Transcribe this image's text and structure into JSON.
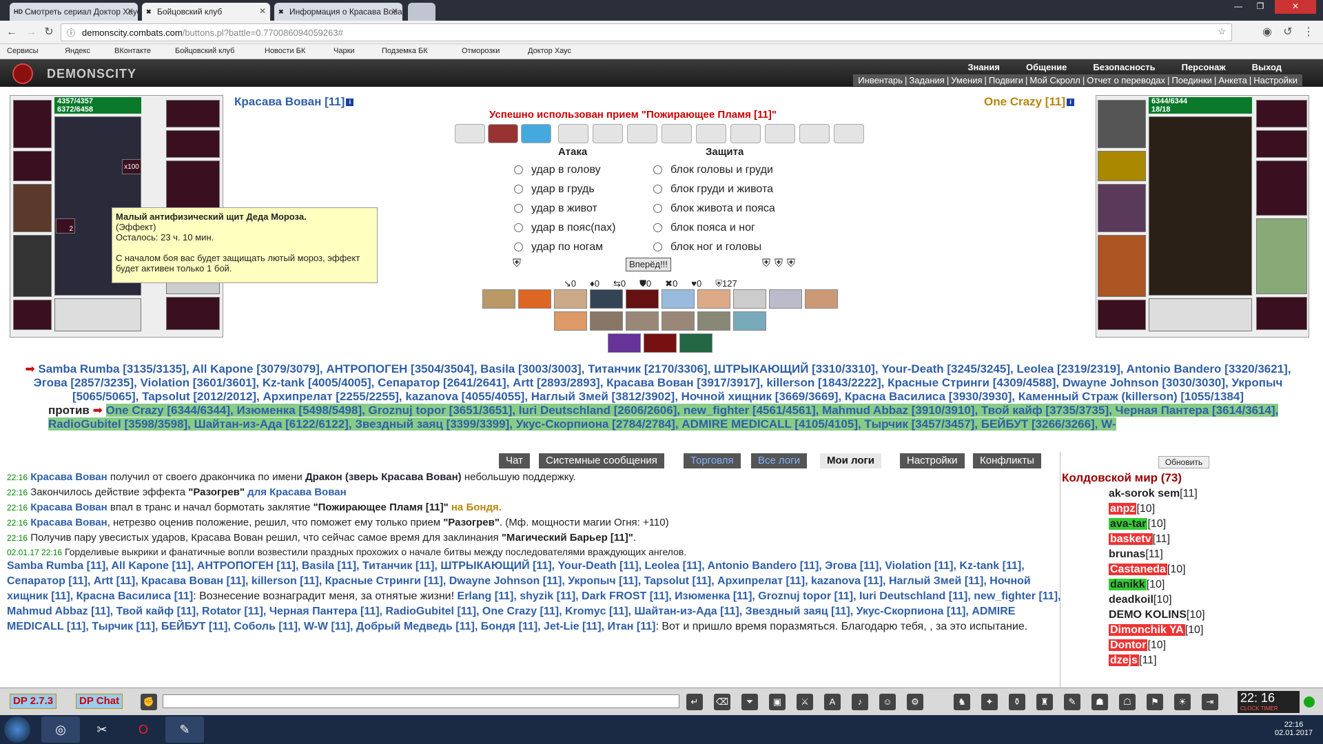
{
  "browser": {
    "tabs": [
      {
        "title": "Смотреть сериал Доктор Хаус",
        "fav": "HD"
      },
      {
        "title": "Бойцовский клуб",
        "fav": "✖"
      },
      {
        "title": "Информация о Красава Вован",
        "fav": "✖"
      }
    ],
    "url_host": "demonscity.combats.com",
    "url_path": "/buttons.pl?battle=0.770086094059263#",
    "bookmarks": [
      "Сервисы",
      "Яндекс",
      "ВКонтакте",
      "Бойцовский клуб",
      "Новости БК",
      "Чарки",
      "Подземка БК",
      "Отморозки",
      "Доктор Хаус"
    ]
  },
  "game": {
    "logo": "DEMONSCITY",
    "main_menu": [
      "Знания",
      "Общение",
      "Безопасность",
      "Персонаж",
      "Выход"
    ],
    "sub_menu": [
      "Инвентарь",
      "Задания",
      "Умения",
      "Подвиги",
      "Мой Скролл",
      "Отчет о переводах",
      "Поединки",
      "Анкета",
      "Настройки"
    ],
    "player": {
      "name": "Красава Вован [11]",
      "hp": "4357/4357",
      "mana": "6372/6458"
    },
    "opponent": {
      "name": "One Crazy [11]",
      "hp": "6344/6344",
      "mana": "18/18"
    },
    "tooltip": {
      "title": "Малый антифизический щит Деда Мороза.",
      "type": "(Эффект)",
      "remaining": "Осталось: 23 ч. 10 мин.",
      "desc": "С началом боя вас будет защищать лютый мороз, эффект будет активен только 1 бой."
    },
    "slot_badges": [
      "x100",
      "2"
    ],
    "success": "Успешно использован прием \"Пожирающее Пламя [11]\"",
    "attack_head": "Атака",
    "defense_head": "Защита",
    "attacks": [
      "удар в голову",
      "удар в грудь",
      "удар в живот",
      "удар в пояс(пах)",
      "удар по ногам"
    ],
    "defenses": [
      "блок головы и груди",
      "блок груди и живота",
      "блок живота и пояса",
      "блок пояса и ног",
      "блок ног и головы"
    ],
    "forward": "Вперёд!!!",
    "stats": [
      "0",
      "0",
      "0",
      "0",
      "0",
      "0",
      "127"
    ],
    "team_a_text": "Samba Rumba [3135/3135], All Kapone [3079/3079], АНТРОПОГЕН [3504/3504], Basila [3003/3003], Титанчик [2170/3306], ШТРЫКАЮЩИЙ [3310/3310], Your-Death [3245/3245], Leolea [2319/2319], Antonio Bandero [3320/3621], Эгова [2857/3235], Violation [3601/3601], Kz-tank [4005/4005], Сепаратор [2641/2641], Artt [2893/2893], Красава Вован [3917/3917], killerson [1843/2222], Красные Стринги [4309/4588], Dwayne Johnson [3030/3030], Укропыч [5065/5065], Tapsolut [2012/2012], Архипрелат [2255/2255], kazanova [4055/4055], Наглый Змей [3812/3902], Ночной хищник [3669/3669], Красна Василиса [3930/3930], Каменный Страж (killerson) [1055/1384]",
    "vs": "против",
    "team_b_text": "One Crazy [6344/6344], Изюменка [5498/5498], Groznuj topor [3651/3651], Iuri Deutschland [2606/2606], new_fighter [4561/4561], Mahmud Abbaz [3910/3910], Твой кайф [3735/3735], Черная Пантера [3614/3614], RadioGubitel [3598/3598], Шайтан-из-Ада [6122/6122], Звездный заяц [3399/3399], Укус-Скорпиона [2784/2784], ADMIRE MEDICALL [4105/4105], Тырчик [3457/3457], БЕЙБУТ [3266/3266], W-"
  },
  "chat": {
    "tabs": [
      "Чат",
      "Системные сообщения",
      "Торговля",
      "Все логи",
      "Мои логи",
      "Настройки",
      "Конфликты"
    ],
    "lines": [
      {
        "time": "22:16",
        "name": "Красава Вован",
        "text": " получил от своего дракончика по имени ",
        "bold": "Дракон (зверь Красава Вован)",
        "tail": " небольшую поддержку."
      },
      {
        "time": "22:16",
        "name": "",
        "text": "Закончилось действие эффекта ",
        "bold": "\"Разогрев\"",
        "tail": " для Красава Вован"
      },
      {
        "time": "22:16",
        "name": "Красава Вован",
        "text": " впал в транс и начал бормотать заклятие ",
        "bold": "\"Пожирающее Пламя [11]\"",
        "tail": " на Бондя."
      },
      {
        "time": "22:16",
        "name": "Красава Вован",
        "text": ", нетрезво оценив положение, решил, что поможет ему только прием ",
        "bold": "\"Разогрев\"",
        "tail": ". (Мф. мощности магии Огня: +110)"
      },
      {
        "time": "22:16",
        "name": "",
        "text": "Получив пару увесистых ударов, Красава Вован решил, что сейчас самое время для заклинания ",
        "bold": "\"Магический Барьер [11]\"",
        "tail": "."
      },
      {
        "time": "02.01.17 22:16",
        "name": "",
        "text": "Горделивые выкрики и фанатичные вопли возвестили праздных прохожих о начале битвы между последователями враждующих ангелов.",
        "bold": "",
        "tail": ""
      }
    ],
    "roster": "Samba Rumba [11], All Kapone [11], АНТРОПОГЕН [11], Basila [11], Титанчик [11], ШТРЫКАЮЩИЙ [11], Your-Death [11], Leolea [11], Antonio Bandero [11], Эгова [11], Violation [11], Kz-tank [11], Сепаратор [11], Artt [11], Красава Вован [11], killerson [11], Красные Стринги [11], Dwayne Johnson [11], Укропыч [11], Tapsolut [11], Архипрелат [11], kazanova [11], Наглый Змей [11], Ночной хищник [11], Красна Василиса [11]",
    "roster_quote1": ": Вознесение вознаградит меня, за отнятые жизни!",
    "roster2": "Erlang [11], shyzik [11], Dark FROST [11], Изюменка [11], Groznuj topor [11], Iuri Deutschland [11], new_fighter [11], Mahmud Abbaz [11], Твой кайф [11], Rotator [11], Черная Пантера [11], RadioGubitel [11], One Crazy [11], Kromyc [11], Шайтан-из-Ада [11], Звездный заяц [11], Укус-Скорпиона [11], ADMIRE MEDICALL [11], Тырчик [11], БЕЙБУТ [11], Соболь [11], W-W [11], Добрый Медведь [11], Бондя [11], Jet-Lie [11], Итан [11]",
    "roster_quote2": ": Вот и пришло время поразмяться. Благодарю тебя, , за это испытание."
  },
  "online": {
    "refresh": "Обновить",
    "title": "Колдовской мир (73)",
    "users": [
      {
        "name": "ak-sorok sem",
        "lv": "[11]",
        "style": ""
      },
      {
        "name": "anpz",
        "lv": "[10]",
        "style": "red"
      },
      {
        "name": "ava-tar",
        "lv": "[10]",
        "style": "grn"
      },
      {
        "name": "basketv",
        "lv": "[11]",
        "style": "red"
      },
      {
        "name": "brunas",
        "lv": "[11]",
        "style": ""
      },
      {
        "name": "Castaneda",
        "lv": "[10]",
        "style": "red"
      },
      {
        "name": "danikk",
        "lv": "[10]",
        "style": "grn"
      },
      {
        "name": "deadkoil",
        "lv": "[10]",
        "style": ""
      },
      {
        "name": "DEMO KOLINS",
        "lv": "[10]",
        "style": ""
      },
      {
        "name": "Dimonchik YA",
        "lv": "[10]",
        "style": "red"
      },
      {
        "name": "Dontor",
        "lv": "[10]",
        "style": "red"
      },
      {
        "name": "dzejs",
        "lv": "[11]",
        "style": "red"
      }
    ]
  },
  "bottom": {
    "dp1": "DP 2.7.3",
    "dp2": "DP Chat",
    "clock": "22: 16",
    "clock_sub": "CLOCK TIMER"
  },
  "taskbar": {
    "time": "22:16",
    "date": "02.01.2017"
  }
}
